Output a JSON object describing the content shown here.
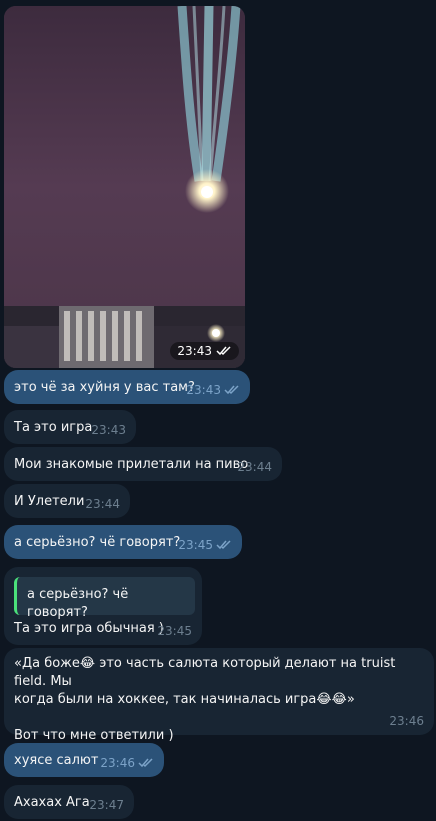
{
  "messages": [
    {
      "id": "photo",
      "type": "photo",
      "direction": "out",
      "time": "23:43",
      "read": true
    },
    {
      "id": "m1",
      "direction": "out",
      "text": "это чё за хуйня у вас там?",
      "time": "23:43",
      "read": true
    },
    {
      "id": "m2",
      "direction": "in",
      "text": "Та это игра",
      "time": "23:43"
    },
    {
      "id": "m3",
      "direction": "in",
      "text": "Мои знакомые прилетали на пиво",
      "time": "23:44"
    },
    {
      "id": "m4",
      "direction": "in",
      "text": "И Улетели",
      "time": "23:44"
    },
    {
      "id": "m5",
      "direction": "out",
      "text": "а серьёзно? чё говорят?",
      "time": "23:45",
      "read": true
    },
    {
      "id": "m6",
      "direction": "in",
      "reply_quote": "а серьёзно? чё говорят?",
      "text": "Та это игра обычная )",
      "time": "23:45"
    },
    {
      "id": "m7",
      "direction": "in",
      "line1a": "«Да боже",
      "emoji": "😂",
      "line1b": " это часть салюта который делают на truist field. Мы",
      "line2a": "когда были на хоккее, так начиналась игра",
      "line2b": "»",
      "line3": "Вот что мне ответили )",
      "time": "23:46"
    },
    {
      "id": "m8",
      "direction": "out",
      "text": "хуясе салют",
      "time": "23:46",
      "read": true
    },
    {
      "id": "m9",
      "direction": "in",
      "text": "Ахахах Ага",
      "time": "23:47"
    }
  ],
  "colors": {
    "background": "#0e1621",
    "outgoing": "#2b5278",
    "incoming": "#182533",
    "read_check": "#7ca3c8"
  }
}
